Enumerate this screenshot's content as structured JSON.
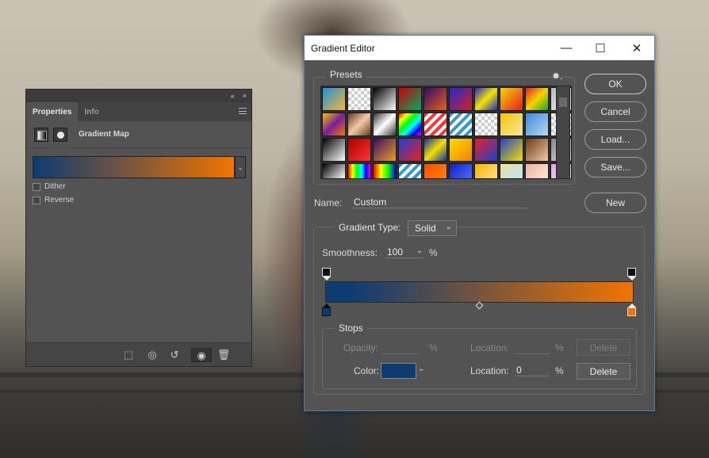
{
  "properties_panel": {
    "collapse_glyph": "«",
    "close_glyph": "×",
    "tabs": [
      {
        "label": "Properties",
        "active": true
      },
      {
        "label": "Info",
        "active": false
      }
    ],
    "adjustment_title": "Gradient Map",
    "gradient": {
      "start_color": "#0d3c72",
      "end_color": "#f27400"
    },
    "options": [
      {
        "label": "Dither",
        "checked": false
      },
      {
        "label": "Reverse",
        "checked": false
      }
    ],
    "footer_icons": [
      "clip-to-layer-icon",
      "view-previous-state-icon",
      "reset-icon",
      "visibility-eye-icon",
      "trash-icon"
    ]
  },
  "gradient_editor": {
    "title": "Gradient Editor",
    "window_controls": {
      "minimize": "—",
      "maximize": "☐",
      "close": "✕"
    },
    "presets_label": "Presets",
    "presets_settings_glyph": "✹.",
    "buttons": {
      "ok": "OK",
      "cancel": "Cancel",
      "load": "Load...",
      "save": "Save...",
      "new": "New"
    },
    "name_label": "Name:",
    "name_value": "Custom",
    "gradient_type_label": "Gradient Type:",
    "gradient_type_value": "Solid",
    "smoothness_label": "Smoothness:",
    "smoothness_value": "100",
    "smoothness_unit": "%",
    "gradient": {
      "start_color": "#0d3c72",
      "end_color": "#f27400",
      "midpoint_percent": 50
    },
    "stops": {
      "legend": "Stops",
      "opacity_label": "Opacity:",
      "opacity_value": "",
      "opacity_unit": "%",
      "location_label_top": "Location:",
      "location_value_top": "",
      "location_unit_top": "%",
      "delete_top": "Delete",
      "color_label": "Color:",
      "color_value": "#0d3c72",
      "location_label_bottom": "Location:",
      "location_value_bottom": "0",
      "location_unit_bottom": "%",
      "delete_bottom": "Delete"
    }
  }
}
